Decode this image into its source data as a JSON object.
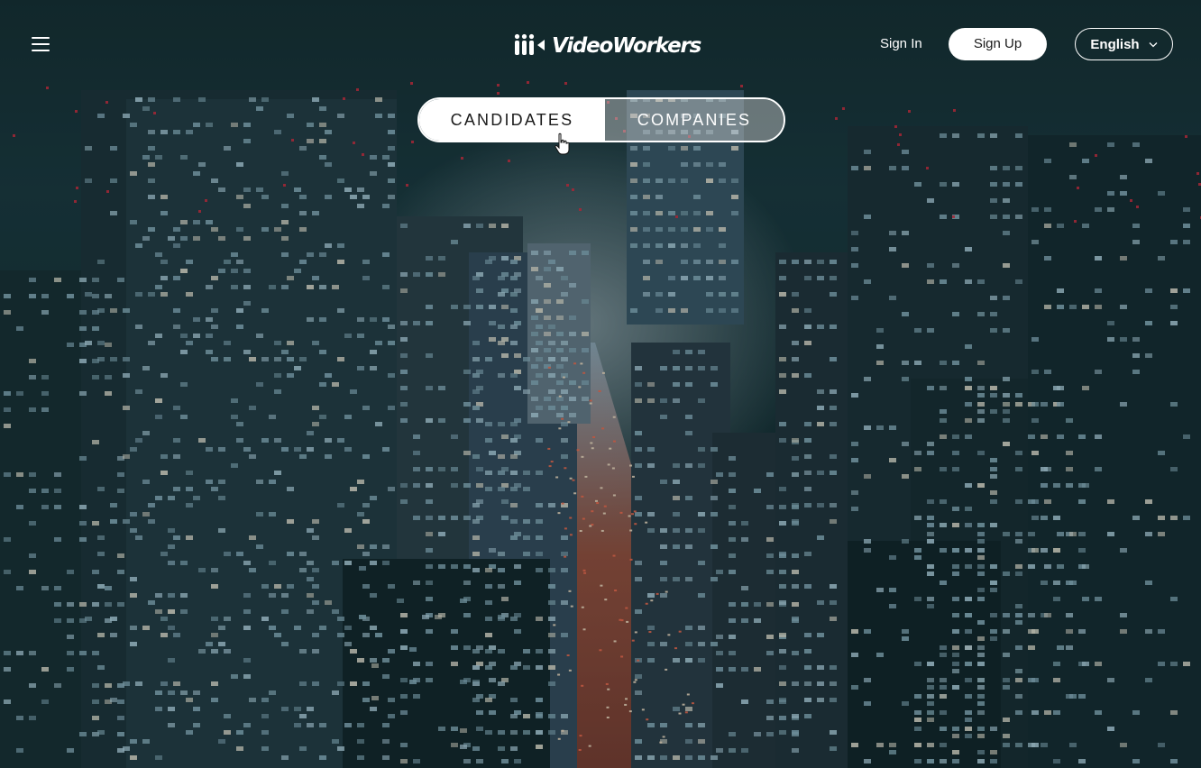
{
  "header": {
    "menu_icon": "hamburger-menu-icon",
    "logo_text": "VideoWorkers",
    "logo_icon": "videoworkers-logo-icon",
    "sign_in_label": "Sign In",
    "sign_up_label": "Sign Up",
    "language": {
      "selected": "English",
      "icon": "chevron-down-icon"
    }
  },
  "segment": {
    "tabs": [
      {
        "label": "CANDIDATES",
        "active": true
      },
      {
        "label": "COMPANIES",
        "active": false
      }
    ]
  },
  "colors": {
    "overlay": "#0f2428",
    "button_fill": "#ffffff",
    "text": "#ffffff"
  }
}
